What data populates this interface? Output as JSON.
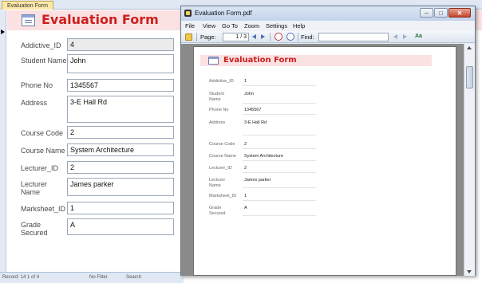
{
  "access": {
    "tab_label": "Evaluation Form",
    "form_title": "Evaluation Form",
    "fields": [
      {
        "label": "Addictive_ID",
        "value": "4"
      },
      {
        "label": "Student Name",
        "value": "John"
      },
      {
        "label": "Phone No",
        "value": "1345567"
      },
      {
        "label": "Address",
        "value": "3-E Hall Rd"
      },
      {
        "label": "Course Code",
        "value": "2"
      },
      {
        "label": "Course Name",
        "value": "System Architecture"
      },
      {
        "label": "Lecturer_ID",
        "value": "2"
      },
      {
        "label": "Lecturer Name",
        "value": "James parker"
      },
      {
        "label": "Marksheet_ID",
        "value": "1"
      },
      {
        "label": "Grade Secured",
        "value": "A"
      }
    ],
    "status": {
      "record": "Record: 14  1 of 4",
      "filter": "No Filter",
      "search": "Search"
    }
  },
  "pdf": {
    "window_title": "Evaluation Form.pdf",
    "menu": [
      "File",
      "View",
      "Go To",
      "Zoom",
      "Settings",
      "Help"
    ],
    "toolbar": {
      "page_label": "Page:",
      "page_value": "1 / 3",
      "find_label": "Find:"
    },
    "page": {
      "title": "Evaluation Form",
      "fields": [
        {
          "label": "Addictive_ID",
          "value": "1"
        },
        {
          "label": "Student Name",
          "value": "John"
        },
        {
          "label": "Phone No",
          "value": "1345567"
        },
        {
          "label": "Address",
          "value": "3-E Hall Rd"
        },
        {
          "label": "Course Code",
          "value": "2"
        },
        {
          "label": "Course Name",
          "value": "System Architecture"
        },
        {
          "label": "Lecturer_ID",
          "value": "2"
        },
        {
          "label": "Lecturer Name",
          "value": "James parker"
        },
        {
          "label": "Marksheet_ID",
          "value": "1"
        },
        {
          "label": "Grade Secured",
          "value": "A"
        }
      ]
    }
  },
  "colors": {
    "title_red": "#cc1f1f",
    "header_pink": "#fbe1e1",
    "tab_yellow": "#fde8a8"
  },
  "icons": [
    "form-icon",
    "folder-icon",
    "zoom-in-icon",
    "zoom-out-icon",
    "prev-icon",
    "next-icon",
    "close-icon",
    "minimize-icon",
    "maximize-icon"
  ]
}
